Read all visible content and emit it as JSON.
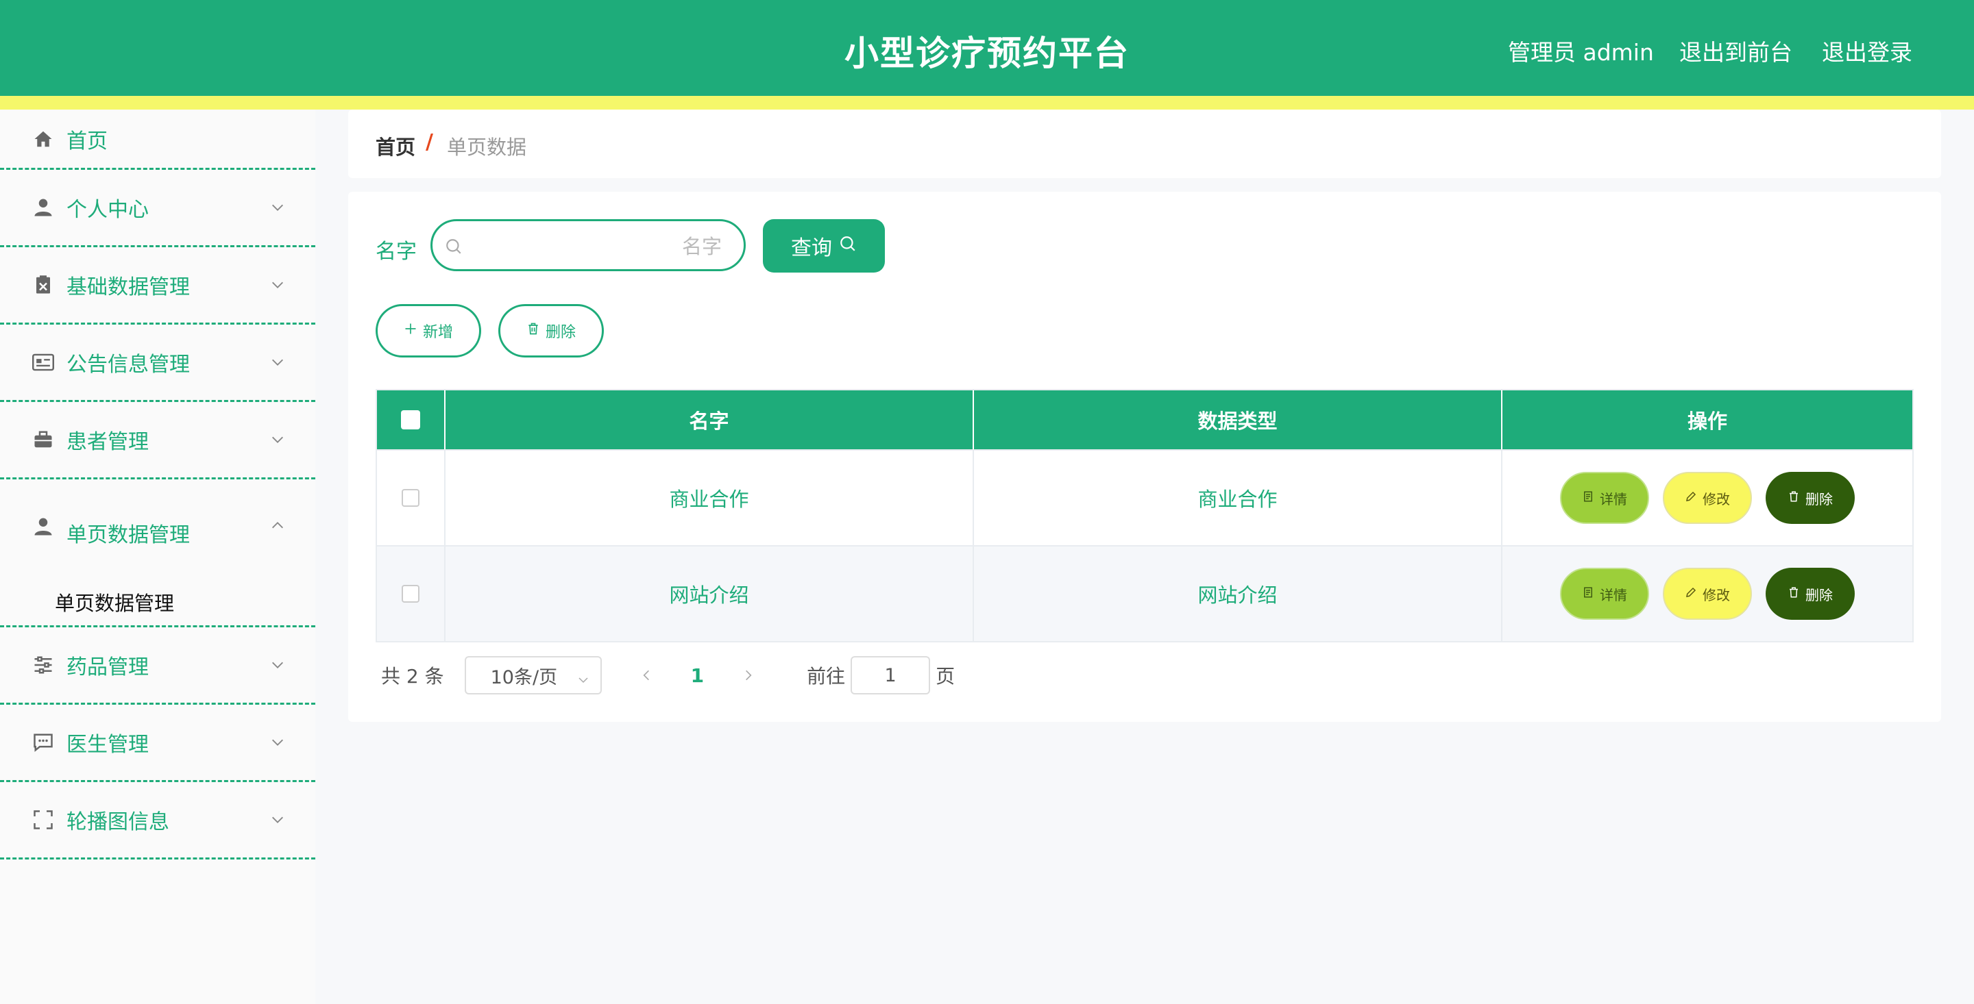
{
  "header": {
    "title": "小型诊疗预约平台",
    "user": "管理员 admin",
    "link_front": "退出到前台",
    "link_logout": "退出登录"
  },
  "sidebar": {
    "items": [
      {
        "label": "首页",
        "icon": "home-icon"
      },
      {
        "label": "个人中心",
        "icon": "user-icon"
      },
      {
        "label": "基础数据管理",
        "icon": "clipboard-icon"
      },
      {
        "label": "公告信息管理",
        "icon": "notice-icon"
      },
      {
        "label": "患者管理",
        "icon": "briefcase-icon"
      },
      {
        "label": "单页数据管理",
        "icon": "user-icon",
        "sub": "单页数据管理"
      },
      {
        "label": "药品管理",
        "icon": "sliders-icon"
      },
      {
        "label": "医生管理",
        "icon": "chat-icon"
      },
      {
        "label": "轮播图信息",
        "icon": "fullscreen-icon"
      }
    ]
  },
  "breadcrumb": {
    "home": "首页",
    "separator": "/",
    "current": "单页数据"
  },
  "search": {
    "label": "名字",
    "placeholder": "名字",
    "value": "",
    "button": "查询"
  },
  "actions": {
    "add": "新增",
    "delete": "删除"
  },
  "table": {
    "columns": [
      "名字",
      "数据类型",
      "操作"
    ],
    "rows": [
      {
        "name": "商业合作",
        "type": "商业合作"
      },
      {
        "name": "网站介绍",
        "type": "网站介绍"
      }
    ],
    "ops": {
      "detail": "详情",
      "edit": "修改",
      "remove": "删除"
    }
  },
  "pagination": {
    "total": "共 2 条",
    "page_size": "10条/页",
    "current_page": "1",
    "goto_label": "前往",
    "goto_value": "1",
    "page_unit": "页"
  },
  "colors": {
    "primary": "#1eac7a",
    "header_stripe": "#f5f76a",
    "detail_btn": "#9ccf3a",
    "edit_btn": "#f9f75e",
    "remove_btn": "#2f5c0b"
  }
}
